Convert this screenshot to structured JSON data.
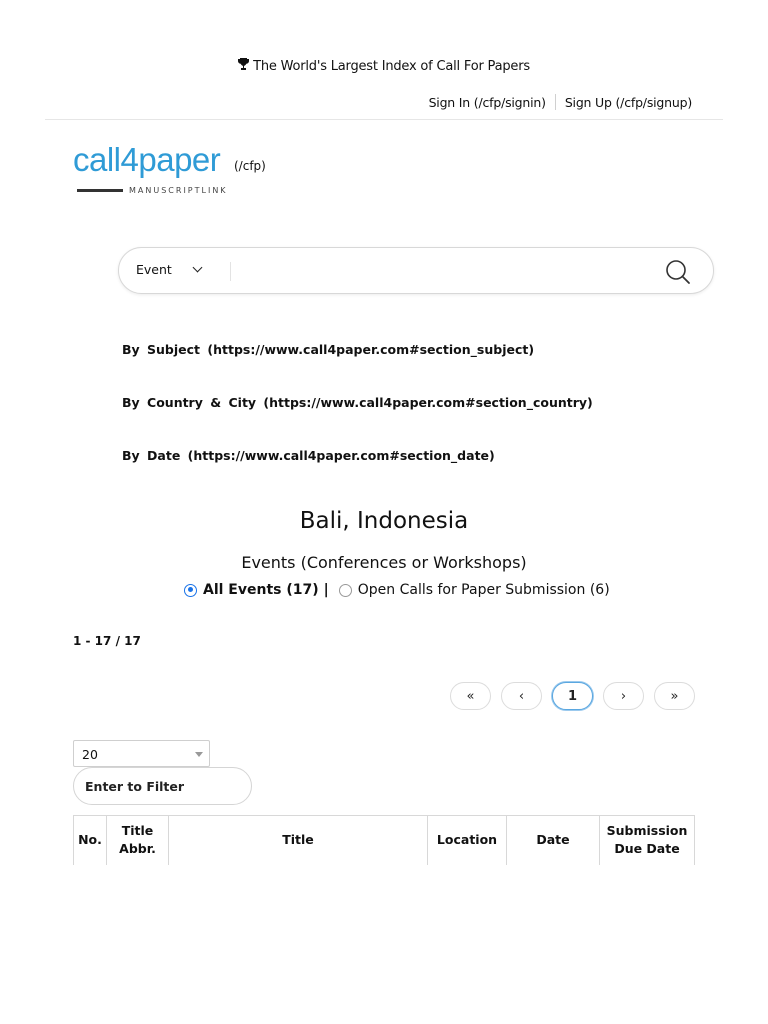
{
  "banner": {
    "text": "The World's Largest Index of Call For Papers"
  },
  "auth": {
    "signin": "Sign In (/cfp/signin)",
    "signup": "Sign Up (/cfp/signup)"
  },
  "logo": {
    "name": "call4paper",
    "cfp": "(/cfp)",
    "sub": "MANUSCRIPTLINK",
    "brand_color": "#2f9bd6"
  },
  "search": {
    "select_value": "Event",
    "input_value": "",
    "placeholder": ""
  },
  "browse": {
    "subject": "By Subject (https://www.call4paper.com#section_subject)",
    "country": "By Country & City (https://www.call4paper.com#section_country)",
    "date": "By Date (https://www.call4paper.com#section_date)"
  },
  "location": {
    "title": "Bali, Indonesia",
    "subtitle": "Events (Conferences or Workshops)"
  },
  "filter_radio": {
    "all": "All Events (17)",
    "separator": "|",
    "open": "Open Calls for Paper Submission (6)"
  },
  "results": {
    "count": "1 - 17 / 17"
  },
  "pagination": {
    "first": "«",
    "prev": "‹",
    "current": "1",
    "next": "›",
    "last": "»"
  },
  "page_size": {
    "value": "20"
  },
  "filter": {
    "placeholder": "Enter to Filter"
  },
  "table": {
    "headers": [
      {
        "line1": "No.",
        "line2": ""
      },
      {
        "line1": "Title",
        "line2": "Abbr."
      },
      {
        "line1": "Title",
        "line2": ""
      },
      {
        "line1": "Location",
        "line2": ""
      },
      {
        "line1": "Date",
        "line2": ""
      },
      {
        "line1": "Submission",
        "line2": "Due Date"
      }
    ]
  },
  "colors": {
    "accent": "#1a73e8",
    "brand": "#2f9bd6"
  },
  "icons": {
    "banner": "trophy-icon",
    "search": "search-icon",
    "select": "chevron-down-icon"
  }
}
